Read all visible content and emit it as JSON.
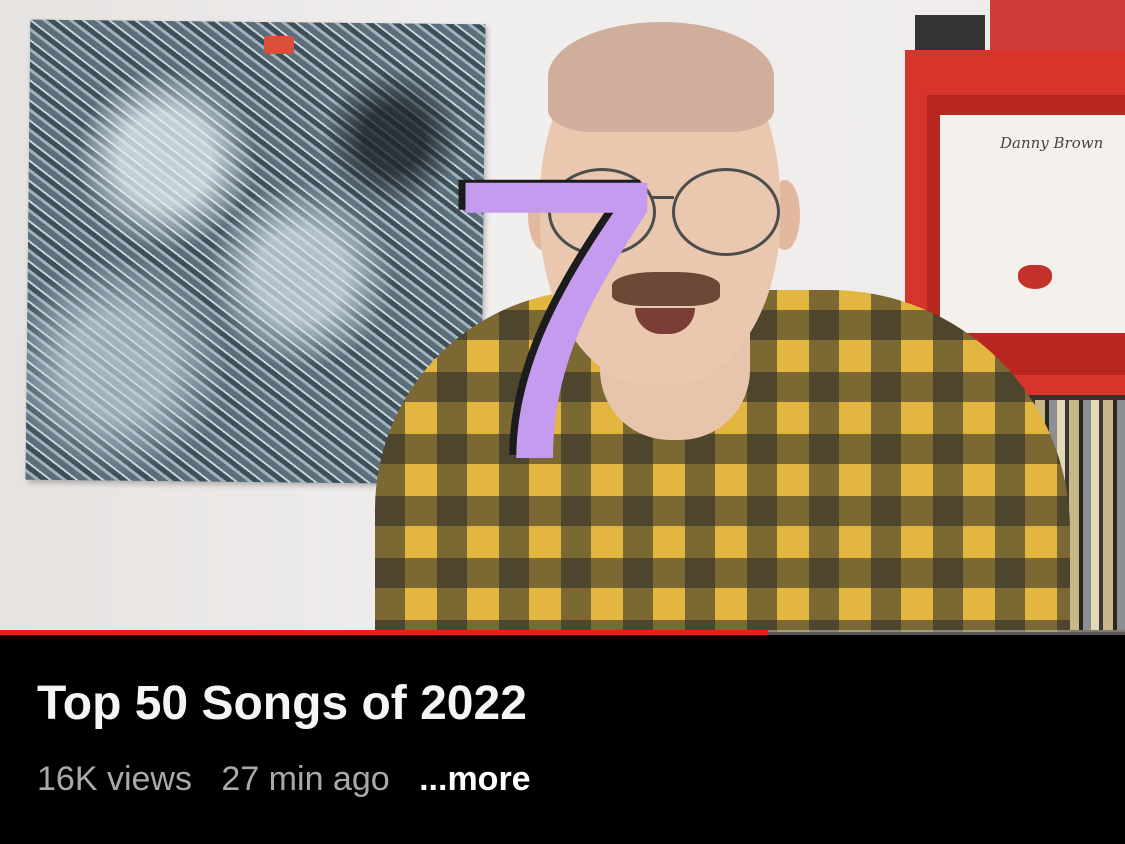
{
  "video": {
    "overlay_number": "7",
    "album_text": "Danny Brown",
    "progress_fraction": 0.683
  },
  "info": {
    "title": "Top 50 Songs of 2022",
    "views": "16K views",
    "time_ago": "27 min ago",
    "more_label": "...more"
  },
  "colors": {
    "progress": "#e62117",
    "overlay_number": "#c49bef"
  }
}
